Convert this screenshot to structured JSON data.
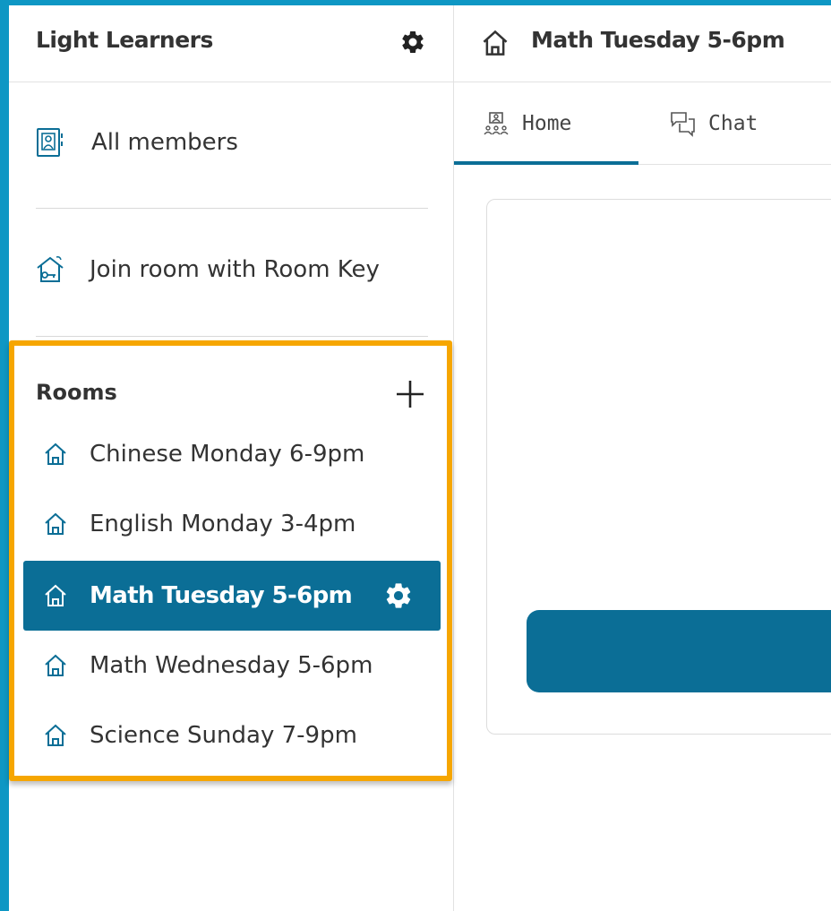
{
  "sidebar": {
    "title": "Light Learners",
    "links": [
      {
        "label": "All members",
        "icon": "members-icon"
      },
      {
        "label": "Join room with Room Key",
        "icon": "room-key-icon"
      }
    ],
    "rooms": {
      "title": "Rooms",
      "items": [
        {
          "label": "Chinese Monday 6-9pm",
          "selected": false
        },
        {
          "label": "English Monday 3-4pm",
          "selected": false
        },
        {
          "label": "Math Tuesday 5-6pm",
          "selected": true
        },
        {
          "label": "Math Wednesday 5-6pm",
          "selected": false
        },
        {
          "label": "Science Sunday 7-9pm",
          "selected": false
        }
      ],
      "highlight_color": "#f6a600",
      "selected_color": "#0b6e96"
    }
  },
  "main": {
    "title": "Math Tuesday 5-6pm",
    "tabs": [
      {
        "label": "Home",
        "active": true
      },
      {
        "label": "Chat",
        "active": false
      }
    ]
  },
  "colors": {
    "accent": "#0b6e96",
    "frame": "#0e97c4"
  }
}
